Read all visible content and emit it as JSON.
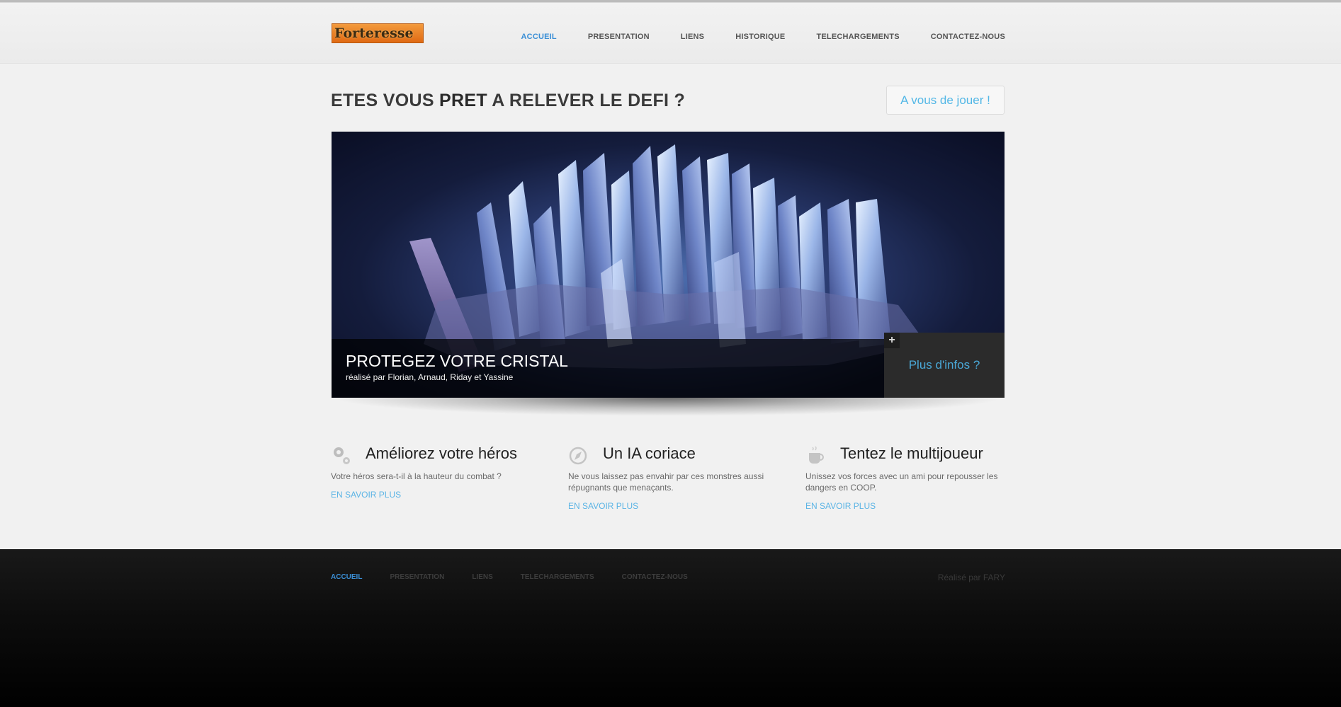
{
  "logo": {
    "text": "Forteresse"
  },
  "nav": {
    "items": [
      "ACCUEIL",
      "PRESENTATION",
      "LIENS",
      "HISTORIQUE",
      "TELECHARGEMENTS",
      "CONTACTEZ-NOUS"
    ],
    "active": "ACCUEIL"
  },
  "headline": {
    "before": "ETES VOUS ",
    "bold": "PRET",
    "after": " A RELEVER LE DEFI ?"
  },
  "play_button": "A vous de jouer !",
  "slider": {
    "caption_title": "PROTEGEZ VOTRE CRISTAL",
    "caption_sub": "réalisé par Florian, Arnaud, Riday et Yassine",
    "more_link": "Plus d'infos ?",
    "plus": "+"
  },
  "features": [
    {
      "icon": "gears-icon",
      "title": "Améliorez votre héros",
      "text": "Votre héros sera-t-il à la hauteur du combat ?",
      "link": "EN SAVOIR PLUS"
    },
    {
      "icon": "compass-icon",
      "title": "Un IA coriace",
      "text": "Ne vous laissez pas envahir par ces monstres aussi répugnants que menaçants.",
      "link": "EN SAVOIR PLUS"
    },
    {
      "icon": "coffee-cup-icon",
      "title": "Tentez le multijoueur",
      "text": "Unissez vos forces avec un ami pour repousser les dangers en COOP.",
      "link": "EN SAVOIR PLUS"
    }
  ],
  "footer": {
    "nav": [
      "ACCUEIL",
      "PRESENTATION",
      "LIENS",
      "TELECHARGEMENTS",
      "CONTACTEZ-NOUS"
    ],
    "credit": "Réalisé par FARY"
  },
  "colors": {
    "accent": "#3b8fd6",
    "link": "#5bb4e5",
    "footer_bg": "#000000"
  }
}
